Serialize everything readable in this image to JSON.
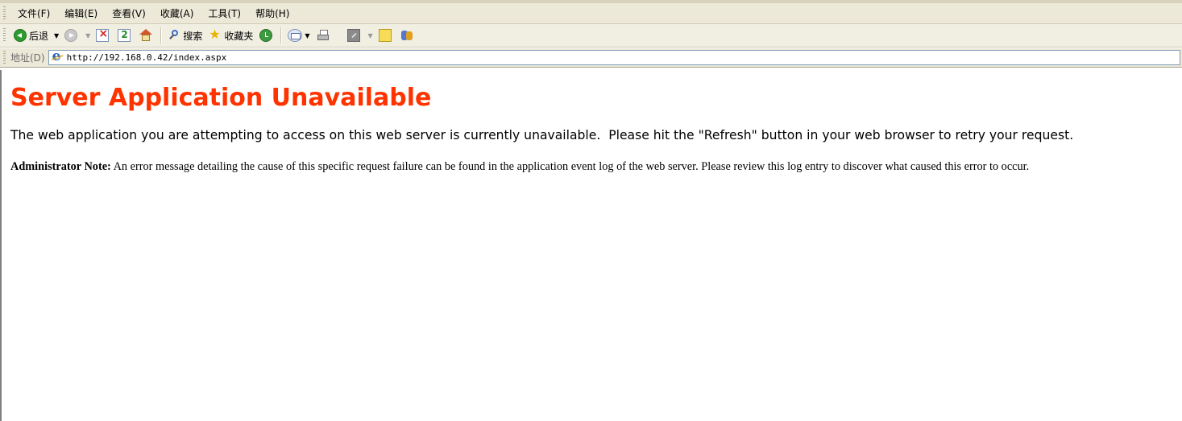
{
  "menubar": {
    "items": [
      "文件(F)",
      "编辑(E)",
      "查看(V)",
      "收藏(A)",
      "工具(T)",
      "帮助(H)"
    ]
  },
  "toolbar": {
    "back_label": "后退",
    "search_label": "搜索",
    "favorites_label": "收藏夹",
    "icons": [
      "back-icon",
      "forward-icon",
      "stop-icon",
      "refresh-icon",
      "home-icon",
      "search-icon",
      "favorites-icon",
      "history-icon",
      "mail-icon",
      "print-icon",
      "edit-icon",
      "discuss-icon",
      "messenger-icon"
    ]
  },
  "addressbar": {
    "label": "地址(D)",
    "url": "http://192.168.0.42/index.aspx"
  },
  "page": {
    "title": "Server Application Unavailable",
    "message": "The web application you are attempting to access on this web server is currently unavailable.  Please hit the \"Refresh\" button in your web browser to retry your request.",
    "admin_note_label": "Administrator Note:",
    "admin_note_text": " An error message detailing the cause of this specific request failure can be found in the application event log of the web server. Please review this log entry to discover what caused this error to occur."
  },
  "colors": {
    "title": "#ff3300",
    "chrome": "#ece9d8"
  }
}
